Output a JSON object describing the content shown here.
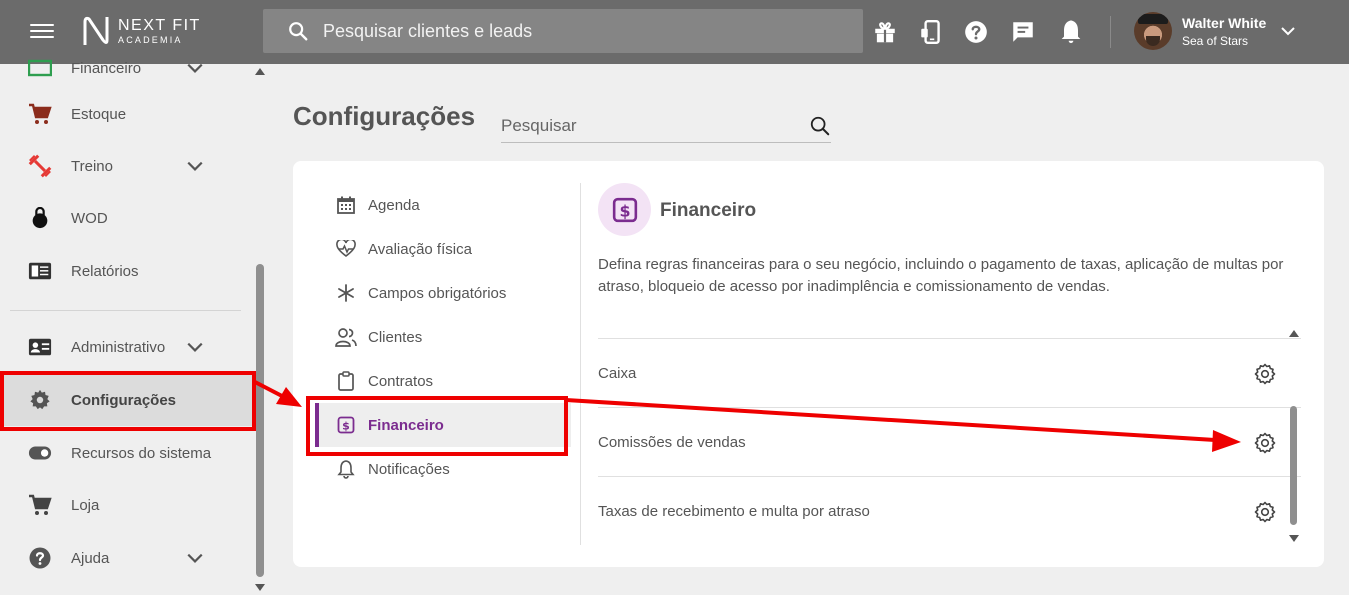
{
  "topbar": {
    "logo_name": "NEXT FIT",
    "logo_sub": "ACADEMIA",
    "search_placeholder": "Pesquisar clientes e leads",
    "user_name": "Walter White",
    "user_sub": "Sea of Stars"
  },
  "sidebar": {
    "items": [
      {
        "label": "Financeiro",
        "icon": "cash-icon"
      },
      {
        "label": "Estoque",
        "icon": "cart-icon"
      },
      {
        "label": "Treino",
        "icon": "dumbbell-icon"
      },
      {
        "label": "WOD",
        "icon": "kettlebell-icon"
      },
      {
        "label": "Relatórios",
        "icon": "report-icon"
      },
      {
        "label": "Administrativo",
        "icon": "id-card-icon"
      },
      {
        "label": "Configurações",
        "icon": "gear-icon"
      },
      {
        "label": "Recursos do sistema",
        "icon": "toggle-icon"
      },
      {
        "label": "Loja",
        "icon": "cart-icon"
      },
      {
        "label": "Ajuda",
        "icon": "help-icon"
      }
    ]
  },
  "main": {
    "title": "Configurações",
    "search_placeholder": "Pesquisar",
    "nav": [
      {
        "label": "Agenda",
        "icon": "calendar-icon"
      },
      {
        "label": "Avaliação física",
        "icon": "heart-pulse-icon"
      },
      {
        "label": "Campos obrigatórios",
        "icon": "asterisk-icon"
      },
      {
        "label": "Clientes",
        "icon": "people-icon"
      },
      {
        "label": "Contratos",
        "icon": "clipboard-icon"
      },
      {
        "label": "Financeiro",
        "icon": "dollar-icon"
      },
      {
        "label": "Notificações",
        "icon": "bell-icon"
      }
    ],
    "section": {
      "title": "Financeiro",
      "description": "Defina regras financeiras para o seu negócio, incluindo o pagamento de taxas, aplicação de multas por atraso, bloqueio de acesso por inadimplência e comissionamento de vendas.",
      "rows": [
        {
          "label": "Caixa"
        },
        {
          "label": "Comissões de vendas"
        },
        {
          "label": "Taxas de recebimento e multa por atraso"
        }
      ]
    }
  },
  "colors": {
    "topbar": "#6b6b6b",
    "accent": "#7b2c8f",
    "annotation": "#ee0000"
  }
}
